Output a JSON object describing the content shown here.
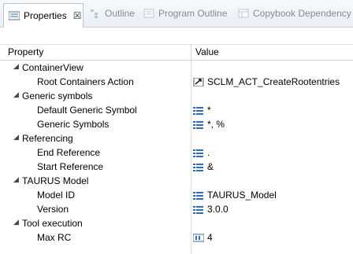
{
  "tabs": [
    {
      "label": "Properties",
      "active": true
    },
    {
      "label": "Outline"
    },
    {
      "label": "Program Outline"
    },
    {
      "label": "Copybook Dependency"
    }
  ],
  "close_glyph": "☒",
  "columns": {
    "property": "Property",
    "value": "Value"
  },
  "groups": [
    {
      "label": "ContainerView",
      "items": [
        {
          "name": "Root Containers Action",
          "value": "SCLM_ACT_CreateRootentries",
          "icon": "action-icon"
        }
      ]
    },
    {
      "label": "Generic symbols",
      "items": [
        {
          "name": "Default Generic Symbol",
          "value": "*",
          "icon": "list-icon"
        },
        {
          "name": "Generic Symbols",
          "value": "*, %",
          "icon": "list-icon"
        }
      ]
    },
    {
      "label": "Referencing",
      "items": [
        {
          "name": "End Reference",
          "value": ".",
          "icon": "list-icon"
        },
        {
          "name": "Start Reference",
          "value": "&",
          "icon": "list-icon"
        }
      ]
    },
    {
      "label": "TAURUS Model",
      "items": [
        {
          "name": "Model ID",
          "value": "TAURUS_Model",
          "icon": "list-icon"
        },
        {
          "name": "Version",
          "value": "3.0.0",
          "icon": "list-icon"
        }
      ]
    },
    {
      "label": "Tool execution",
      "items": [
        {
          "name": "Max RC",
          "value": "4",
          "icon": "number-icon"
        }
      ]
    }
  ],
  "colors": {
    "icon_blue": "#2f6db5",
    "tab_border": "#b9c4d3"
  }
}
